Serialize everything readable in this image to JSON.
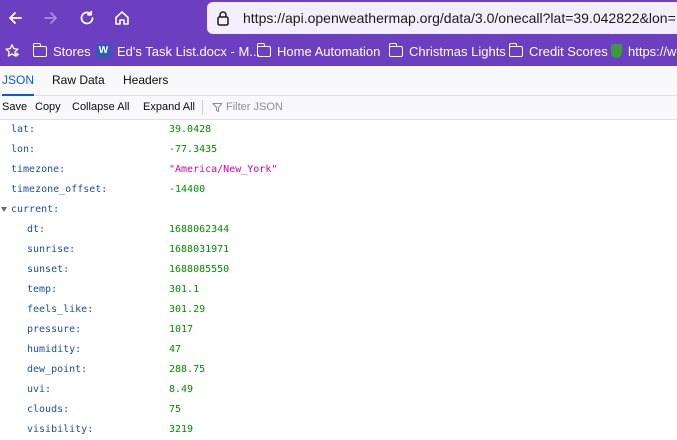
{
  "browser": {
    "url": "https://api.openweathermap.org/data/3.0/onecall?lat=39.042822&lon=",
    "bookmarks": [
      {
        "label": "Stores",
        "icon": "folder-icon"
      },
      {
        "label": "Ed's Task List.docx - M...",
        "icon": "word-doc-icon"
      },
      {
        "label": "Home Automation",
        "icon": "folder-icon"
      },
      {
        "label": "Christmas Lights",
        "icon": "folder-icon"
      },
      {
        "label": "Credit Scores",
        "icon": "folder-icon"
      },
      {
        "label": "https://w",
        "icon": "shield-icon"
      }
    ],
    "colors": {
      "toolbar": "#6c3fc0",
      "url_bg": "#f3eefb"
    }
  },
  "viewer": {
    "tabs": [
      "JSON",
      "Raw Data",
      "Headers"
    ],
    "active_tab": "JSON",
    "actions": [
      "Save",
      "Copy",
      "Collapse All",
      "Expand All"
    ],
    "filter_placeholder": "Filter JSON"
  },
  "json_rows": [
    {
      "key": "lat:",
      "value": "39.0428",
      "type": "number",
      "indent": 0
    },
    {
      "key": "lon:",
      "value": "-77.3435",
      "type": "number",
      "indent": 0
    },
    {
      "key": "timezone:",
      "value": "\"America/New_York\"",
      "type": "string",
      "indent": 0
    },
    {
      "key": "timezone_offset:",
      "value": "-14400",
      "type": "number",
      "indent": 0
    },
    {
      "key": "current:",
      "value": "",
      "type": "object",
      "indent": 0,
      "expanded": true
    },
    {
      "key": "dt:",
      "value": "1688062344",
      "type": "number",
      "indent": 1
    },
    {
      "key": "sunrise:",
      "value": "1688031971",
      "type": "number",
      "indent": 1
    },
    {
      "key": "sunset:",
      "value": "1688085550",
      "type": "number",
      "indent": 1
    },
    {
      "key": "temp:",
      "value": "301.1",
      "type": "number",
      "indent": 1
    },
    {
      "key": "feels_like:",
      "value": "301.29",
      "type": "number",
      "indent": 1
    },
    {
      "key": "pressure:",
      "value": "1017",
      "type": "number",
      "indent": 1
    },
    {
      "key": "humidity:",
      "value": "47",
      "type": "number",
      "indent": 1
    },
    {
      "key": "dew_point:",
      "value": "288.75",
      "type": "number",
      "indent": 1
    },
    {
      "key": "uvi:",
      "value": "8.49",
      "type": "number",
      "indent": 1
    },
    {
      "key": "clouds:",
      "value": "75",
      "type": "number",
      "indent": 1
    },
    {
      "key": "visibility:",
      "value": "3219",
      "type": "number",
      "indent": 1
    }
  ]
}
